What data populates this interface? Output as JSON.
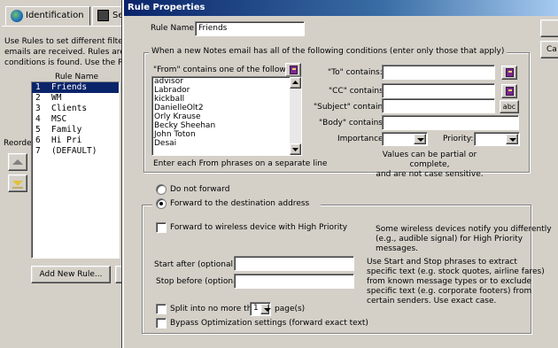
{
  "background_window": {
    "tabs": [
      {
        "label": "Identification",
        "icon": "globe-icon"
      },
      {
        "label": "Se",
        "icon": "settings-icon"
      }
    ],
    "description_lines": [
      "Use Rules to set different filtering a",
      "emails are received.  Rules are eva",
      "conditions is found.  Use the Reord"
    ],
    "reorder_label": "Reorder",
    "list_header": "Rule Name",
    "rules": [
      {
        "num": "1",
        "name": "Friends",
        "selected": true
      },
      {
        "num": "2",
        "name": "WM"
      },
      {
        "num": "3",
        "name": "Clients"
      },
      {
        "num": "4",
        "name": "MSC"
      },
      {
        "num": "5",
        "name": "Family"
      },
      {
        "num": "6",
        "name": "Hi Pri"
      },
      {
        "num": "7",
        "name": "(DEFAULT)"
      }
    ],
    "add_button_label": "Add New Rule..."
  },
  "dialog": {
    "title": "Rule Properties",
    "side_button_label": "Ca",
    "rule_name_label": "Rule Name:",
    "rule_name_value": "Friends",
    "conditions_legend": "When a new Notes email has all of the following conditions (enter only those that apply)",
    "from_label": "\"From\" contains one of the following:",
    "from_items": [
      "advisor",
      "Labrador",
      "kickball",
      "DanielleOlt2",
      "Orly Krause",
      "Becky Sheehan",
      "John Toton",
      "Desai"
    ],
    "from_hint": "Enter each From phrases on a separate line",
    "to_label": "\"To\" contains:",
    "to_value": "",
    "cc_label": "\"CC\" contains:",
    "cc_value": "",
    "subject_label": "\"Subject\" contains:",
    "subject_value": "",
    "abc_label": "abc",
    "body_label": "\"Body\" contains:",
    "body_value": "",
    "importance_label": "Importance:",
    "importance_value": "",
    "priority_label": "Priority:",
    "priority_value": "",
    "values_note_line1": "Values can be partial or complete,",
    "values_note_line2": "and are not case sensitive.",
    "do_not_forward_label": "Do not forward",
    "forward_label": "Forward to the destination address",
    "forward_wireless_label": "Forward to wireless device with High Priority",
    "wireless_note_line1": "Some wireless devices notify you differently",
    "wireless_note_line2": "(e.g., audible signal) for High Priority messages.",
    "start_after_label": "Start after (optional):",
    "start_after_value": "",
    "stop_before_label": "Stop before (optional):",
    "stop_before_value": "",
    "start_stop_note": [
      "Use Start and Stop phrases to extract",
      "specific text (e.g. stock quotes, airline fares)",
      "from known message types or to exclude",
      "specific text (e.g. corporate footers) from",
      "certain senders.  Use exact case."
    ],
    "split_label": "Split into no more than",
    "split_value": "1",
    "split_suffix": "page(s)",
    "bypass_label": "Bypass Optimization settings (forward exact text)"
  }
}
